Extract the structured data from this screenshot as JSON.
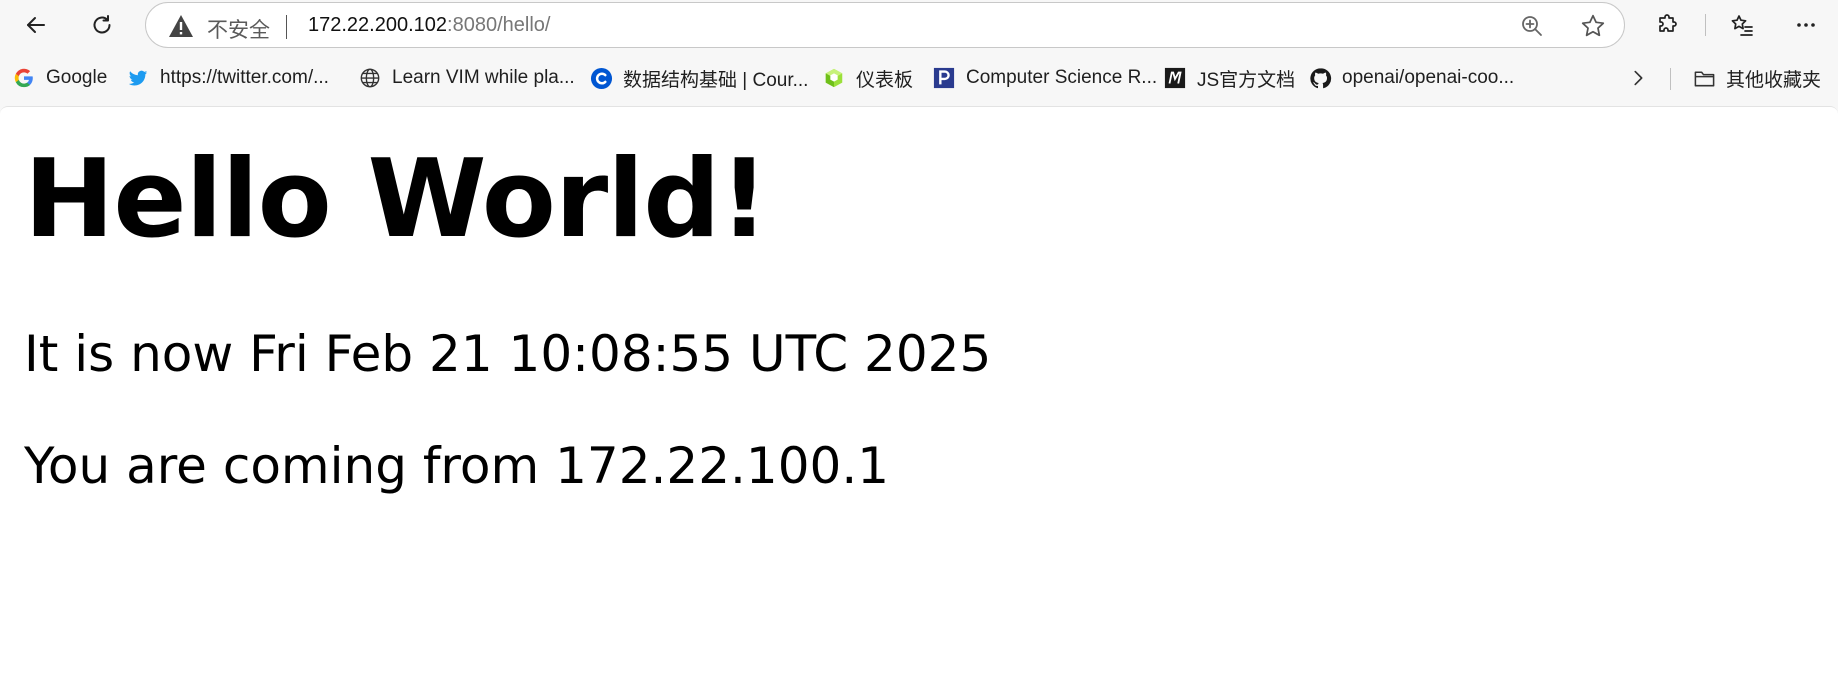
{
  "toolbar": {
    "security_label": "不安全",
    "url_host": "172.22.200.102",
    "url_rest": ":8080/hello/"
  },
  "bookmarks": [
    {
      "label": "Google",
      "icon": "google-icon"
    },
    {
      "label": "https://twitter.com/...",
      "icon": "twitter-icon"
    },
    {
      "label": "Learn VIM while pla...",
      "icon": "globe-icon"
    },
    {
      "label": "数据结构基础 | Cour...",
      "icon": "coursera-icon"
    },
    {
      "label": "仪表板",
      "icon": "cube-icon"
    },
    {
      "label": "Computer Science R...",
      "icon": "p-logo-icon"
    },
    {
      "label": "JS官方文档",
      "icon": "m-logo-icon"
    },
    {
      "label": "openai/openai-coo...",
      "icon": "github-icon"
    }
  ],
  "other_bookmarks_label": "其他收藏夹",
  "page": {
    "heading": "Hello World!",
    "time_line": "It is now Fri Feb 21 10:08:55 UTC 2025",
    "from_line": "You are coming from 172.22.100.1"
  },
  "colors": {
    "twitter": "#1d9bf0",
    "coursera": "#0056d2",
    "cube": "#7bd41a",
    "p_logo": "#2a3b8f",
    "github": "#1a1a1a"
  }
}
